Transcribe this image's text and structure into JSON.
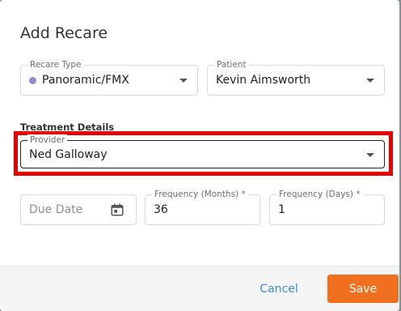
{
  "dialog": {
    "title": "Add Recare",
    "recare_type": {
      "label": "Recare Type",
      "value": "Panoramic/FMX",
      "dot_color": "#8a8fcf"
    },
    "patient": {
      "label": "Patient",
      "value": "Kevin Aimsworth"
    },
    "treatment_heading": "Treatment Details",
    "provider": {
      "label": "Provider",
      "value": "Ned Galloway"
    },
    "due_date": {
      "placeholder": "Due Date"
    },
    "frequency_months": {
      "label": "Frequency (Months) *",
      "value": "36"
    },
    "frequency_days": {
      "label": "Frequency (Days) *",
      "value": "1"
    },
    "footer": {
      "cancel_label": "Cancel",
      "save_label": "Save"
    }
  },
  "colors": {
    "accent": "#f07020",
    "link": "#3a8fd9",
    "highlight": "#e60000"
  }
}
